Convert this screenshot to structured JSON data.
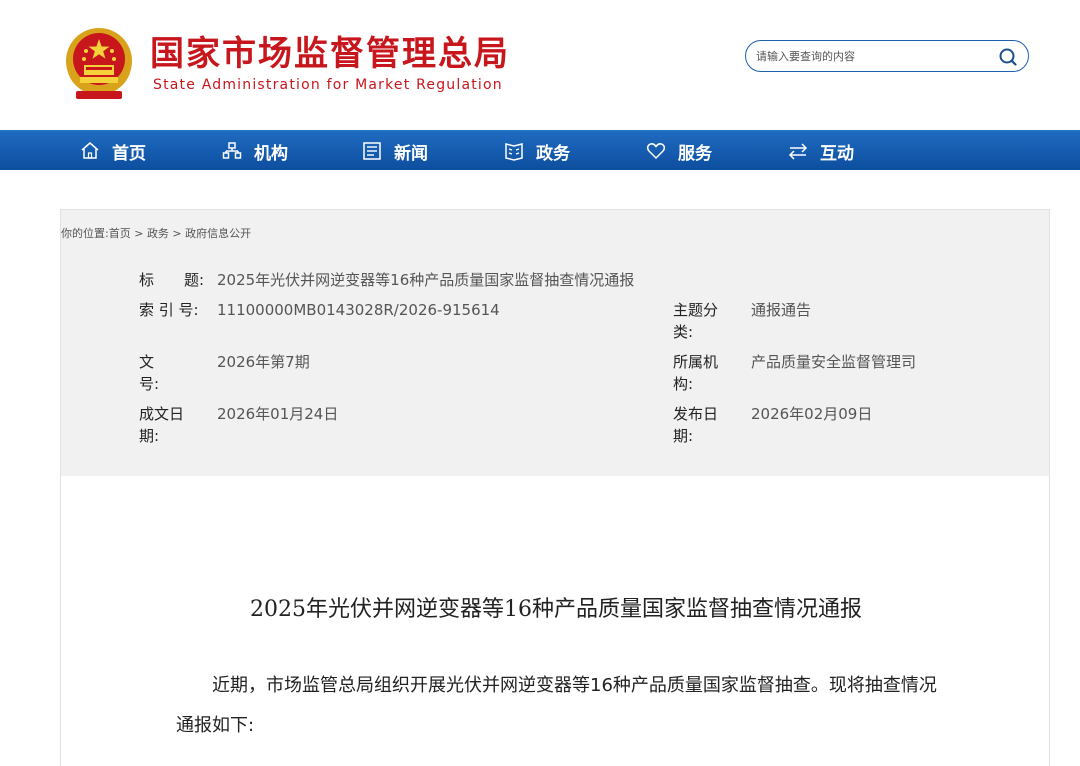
{
  "header": {
    "title_cn": "国家市场监督管理总局",
    "title_en": "State Administration for Market Regulation",
    "search_placeholder": "请输入要查询的内容",
    "emblem_icon": "national-emblem-icon",
    "brand_color": "#c8161d"
  },
  "nav": {
    "items": [
      {
        "label": "首页",
        "icon": "home-icon"
      },
      {
        "label": "机构",
        "icon": "org-chart-icon"
      },
      {
        "label": "新闻",
        "icon": "newspaper-icon"
      },
      {
        "label": "政务",
        "icon": "document-icon"
      },
      {
        "label": "服务",
        "icon": "heart-icon"
      },
      {
        "label": "互动",
        "icon": "swap-arrows-icon"
      }
    ],
    "background": "#0d4e9f"
  },
  "breadcrumb": {
    "prefix": "你的位置:",
    "items": [
      "首页",
      "政务",
      "政府信息公开"
    ],
    "separator": " > "
  },
  "info": {
    "title_label": "标　　题:",
    "title_value": "2025年光伏并网逆变器等16种产品质量国家监督抽查情况通报",
    "index_label": "索 引 号:",
    "index_value": "11100000MB0143028R/2026-915614",
    "topic_label": "主题分类:",
    "topic_value": "通报通告",
    "docno_label": "文　　号:",
    "docno_value": "2026年第7期",
    "org_label": "所属机构:",
    "org_value": "产品质量安全监督管理司",
    "written_label": "成文日期:",
    "written_value": "2026年01月24日",
    "published_label": "发布日期:",
    "published_value": "2026年02月09日"
  },
  "article": {
    "title": "2025年光伏并网逆变器等16种产品质量国家监督抽查情况通报",
    "paragraph1": "近期，市场监管总局组织开展光伏并网逆变器等16种产品质量国家监督抽查。现将抽查情况通报如下:"
  }
}
